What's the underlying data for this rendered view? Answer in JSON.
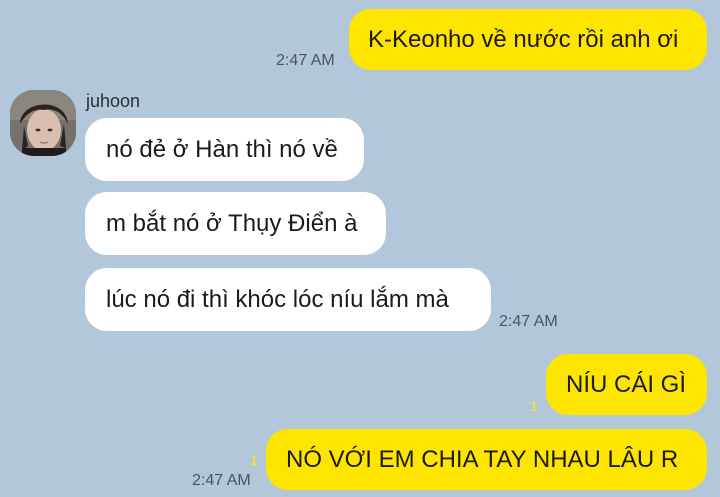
{
  "messages": [
    {
      "id": "m1",
      "direction": "sent",
      "text": "K-Keonho về nước rồi anh ơi",
      "time": "2:47 AM"
    },
    {
      "id": "m2",
      "direction": "received",
      "sender": "juhoon",
      "text": "nó đẻ ở Hàn thì nó về"
    },
    {
      "id": "m3",
      "direction": "received",
      "sender": "juhoon",
      "text": "m bắt nó ở Thụy Điển à"
    },
    {
      "id": "m4",
      "direction": "received",
      "sender": "juhoon",
      "text": "lúc nó đi thì khóc lóc níu lắm mà",
      "time": "2:47 AM"
    },
    {
      "id": "m5",
      "direction": "sent",
      "text": "NÍU CÁI GÌ",
      "unread": "1"
    },
    {
      "id": "m6",
      "direction": "sent",
      "text": "NÓ VỚI EM CHIA TAY NHAU LÂU R",
      "unread": "1",
      "time": "2:47 AM"
    }
  ],
  "contact": {
    "name": "juhoon",
    "avatar_icon": "profile-photo"
  },
  "colors": {
    "background": "#b2c7d9",
    "sent_bubble": "#fee500",
    "received_bubble": "#ffffff",
    "unread_count": "#f2e13a",
    "timestamp": "#4a5663"
  }
}
